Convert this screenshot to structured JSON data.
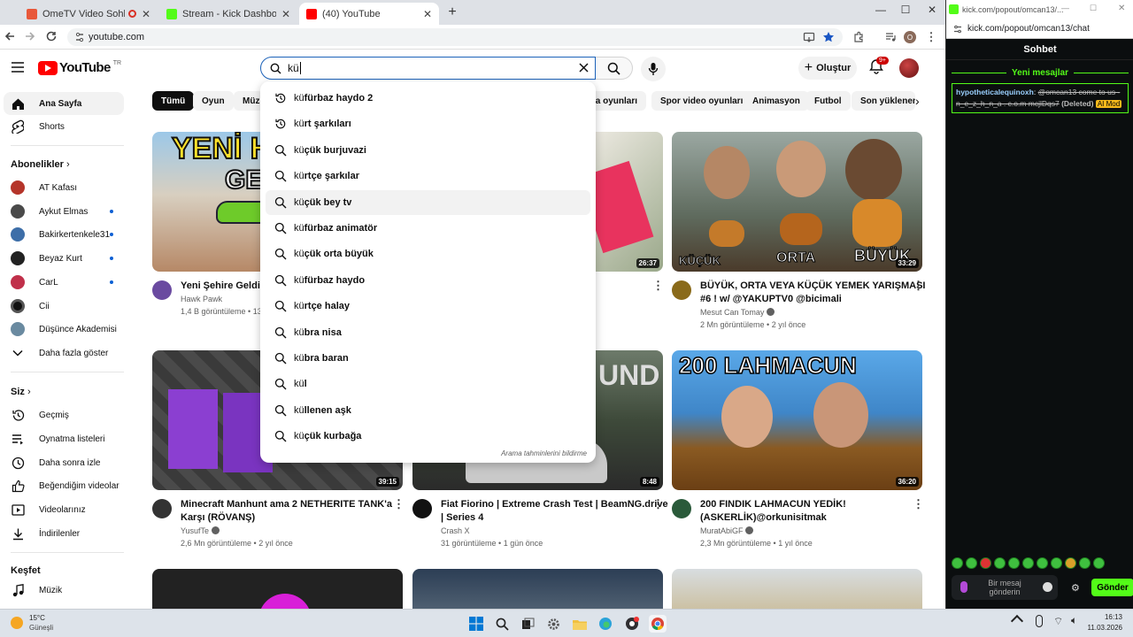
{
  "browser": {
    "tabs": [
      {
        "title": "OmeTV Video Sohbeti — O",
        "favicon_color": "#e8583a"
      },
      {
        "title": "Stream - Kick Dashboard",
        "favicon_color": "#53fc18"
      },
      {
        "title": "(40) YouTube",
        "favicon_color": "#ff0000"
      }
    ],
    "active_tab": 2,
    "url": "youtube.com",
    "profile_initial": "O"
  },
  "youtube": {
    "logo_text": "YouTube",
    "logo_country": "TR",
    "search_value": "kü",
    "create_label": "Oluştur",
    "notification_count": "9+",
    "suggestions": [
      {
        "prefix": "kü",
        "rest": "fürbaz haydo 2",
        "icon": "history-icon"
      },
      {
        "prefix": "kü",
        "rest": "rt şarkıları",
        "icon": "history-icon"
      },
      {
        "prefix": "kü",
        "rest": "çük burjuvazi",
        "icon": "search-icon"
      },
      {
        "prefix": "kü",
        "rest": "rtçe şarkılar",
        "icon": "search-icon"
      },
      {
        "prefix": "kü",
        "rest": "çük bey tv",
        "icon": "search-icon"
      },
      {
        "prefix": "kü",
        "rest": "fürbaz animatör",
        "icon": "search-icon"
      },
      {
        "prefix": "kü",
        "rest": "çük orta büyük",
        "icon": "search-icon"
      },
      {
        "prefix": "kü",
        "rest": "fürbaz haydo",
        "icon": "search-icon"
      },
      {
        "prefix": "kü",
        "rest": "rtçe halay",
        "icon": "search-icon"
      },
      {
        "prefix": "kü",
        "rest": "bra nisa",
        "icon": "search-icon"
      },
      {
        "prefix": "kü",
        "rest": "bra baran",
        "icon": "search-icon"
      },
      {
        "prefix": "kü",
        "rest": "l",
        "icon": "search-icon"
      },
      {
        "prefix": "kü",
        "rest": "llenen aşk",
        "icon": "search-icon"
      },
      {
        "prefix": "kü",
        "rest": "çük kurbağa",
        "icon": "search-icon"
      }
    ],
    "highlighted_suggestion": 4,
    "suggest_report": "Arama tahminlerini bildirme",
    "sidebar": {
      "home": "Ana Sayfa",
      "shorts": "Shorts",
      "subs_header": "Abonelikler",
      "channels": [
        {
          "name": "AT Kafası",
          "color": "#b5352a",
          "live": false
        },
        {
          "name": "Aykut Elmas",
          "color": "#4a4a4a",
          "live": true
        },
        {
          "name": "Bakirkertenkele31",
          "color": "#3d6ea8",
          "live": true
        },
        {
          "name": "Beyaz Kurt",
          "color": "#222222",
          "live": true
        },
        {
          "name": "CarL",
          "color": "#c0304a",
          "live": true
        },
        {
          "name": "Cii",
          "color": "#111111",
          "live": false
        },
        {
          "name": "Düşünce Akademisi",
          "color": "#6a8aa0",
          "live": false
        }
      ],
      "show_more": "Daha fazla göster",
      "you_header": "Siz",
      "you_items": [
        "Geçmiş",
        "Oynatma listeleri",
        "Daha sonra izle",
        "Beğendiğim videolar",
        "Videolarınız",
        "İndirilenler"
      ],
      "explore_header": "Keşfet",
      "explore_items": [
        "Müzik"
      ]
    },
    "chips": [
      "Tümü",
      "Oyun",
      "Müzik",
      "era oyunları",
      "Spor video oyunları",
      "Animasyon",
      "Futbol",
      "Son yüklenenler"
    ],
    "videos": [
      {
        "title": "Yeni Şehire Geldik!",
        "title2": "",
        "channel": "Hawk Pawk",
        "meta": "1,4 B görüntüleme • 13",
        "duration": "",
        "thumb_text": "YENİ H",
        "thumb_text2": "GE",
        "av": "#6a4aa0"
      },
      {
        "title": "",
        "title2": "",
        "channel": "",
        "meta": "",
        "duration": "26:37",
        "av": "#ccc"
      },
      {
        "title": "BÜYÜK, ORTA VEYA KÜÇÜK YEMEK YARIŞMASI",
        "title2": "#6 ! w/ @YAKUPTV0 @bicimali",
        "channel": "Mesut Can Tomay",
        "meta": "2 Mn görüntüleme • 2 yıl önce",
        "duration": "33:29",
        "thumb_labels": [
          "KÜÇÜK",
          "ORTA",
          "BÜYÜK"
        ],
        "av": "#8a6a1a"
      },
      {
        "title": "Minecraft Manhunt ama 2 NETHERITE TANK'a",
        "title2": "Karşı (RÖVANŞ)",
        "channel": "YusufTe",
        "meta": "2,6 Mn görüntüleme • 2 yıl önce",
        "duration": "39:15",
        "av": "#333"
      },
      {
        "title": "Fiat Fiorino | Extreme Crash Test | BeamNG.drive",
        "title2": "| Series 4",
        "channel": "Crash X",
        "meta": "31 görüntüleme • 1 gün önce",
        "duration": "8:48",
        "thumb_text": "UND",
        "av": "#111"
      },
      {
        "title": "200 FINDIK LAHMACUN YEDİK!",
        "title2": "(ASKERLİK)@orkunisitmak",
        "channel": "MuratAbiGF",
        "meta": "2,3 Mn görüntüleme • 1 yıl önce",
        "duration": "36:20",
        "thumb_text": "200 LAHMACUN",
        "av": "#2a5a3a"
      }
    ]
  },
  "chat": {
    "popout_url": "kick.com/popout/omcan13/...",
    "url": "kick.com/popout/omcan13/chat",
    "header": "Sohbet",
    "new_messages": "Yeni mesajlar",
    "message": {
      "user": "hypotheticalequinoxh",
      "text": "@omcan13 come to us - n_e_z_h_n_a . c.o.m mcjlDqs7",
      "deleted_tag": "(Deleted)",
      "badge": "AI Mod"
    },
    "input_placeholder": "Bir mesaj gönderin",
    "send_label": "Gönder",
    "accent": "#53fc18"
  },
  "taskbar": {
    "weather_temp": "15°C",
    "weather_desc": "Güneşli",
    "time": "16:13",
    "date": "11.03.2026"
  }
}
